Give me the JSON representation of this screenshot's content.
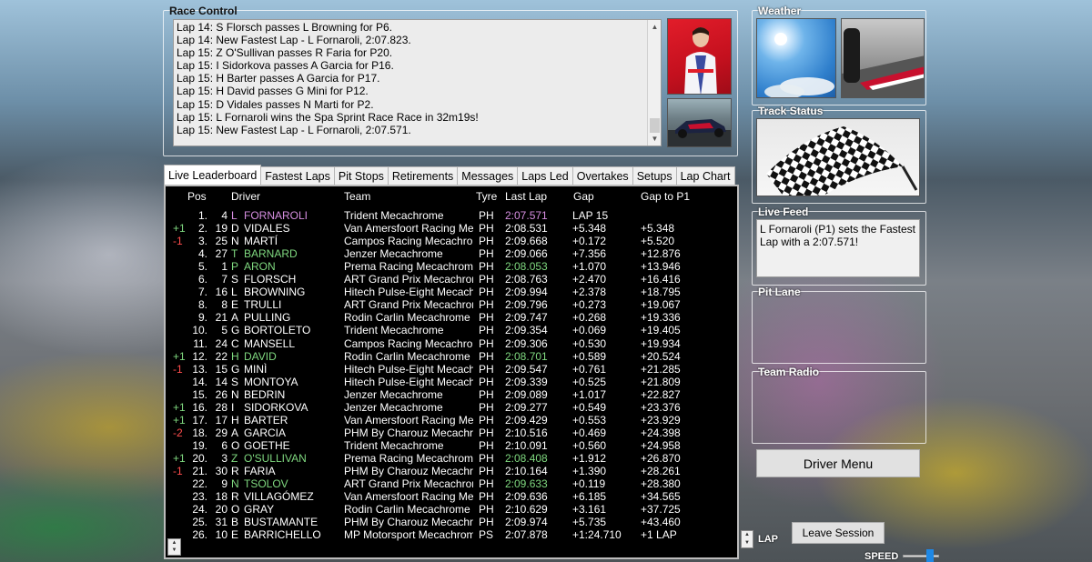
{
  "race_control": {
    "title": "Race Control",
    "messages": [
      "Lap 14: S Florsch passes L Browning for P6.",
      "Lap 14: New Fastest Lap - L Fornaroli, 2:07.823.",
      "Lap 15: Z O'Sullivan passes R Faria for P20.",
      "Lap 15: I Sidorkova passes A Garcia for P16.",
      "Lap 15: H Barter passes A Garcia for P17.",
      "Lap 15: H David passes G Mini for P12.",
      "Lap 15: D Vidales passes N Marti for P2.",
      "Lap 15: L Fornaroli wins the Spa Sprint Race Race in 32m19s!",
      "Lap 15: New Fastest Lap - L Fornaroli, 2:07.571."
    ]
  },
  "tabs": [
    "Live Leaderboard",
    "Fastest Laps",
    "Pit Stops",
    "Retirements",
    "Messages",
    "Laps Led",
    "Overtakes",
    "Setups",
    "Lap Chart"
  ],
  "leaderboard": {
    "headers": {
      "pos": "Pos",
      "driver": "Driver",
      "team": "Team",
      "tyre": "Tyre",
      "last_lap": "Last Lap",
      "gap": "Gap",
      "gap_p1": "Gap to P1"
    },
    "rows": [
      {
        "chg": "",
        "pos": "1.",
        "num": "4",
        "ini": "L",
        "sur": "FORNAROLI",
        "team": "Trident Mecachrome",
        "tyre": "PH",
        "last": "2:07.571",
        "gap": "LAP 15",
        "gp1": "",
        "name_color": "#d68ee0",
        "last_color": "#d68ee0"
      },
      {
        "chg": "+1",
        "pos": "2.",
        "num": "19",
        "ini": "D",
        "sur": "VIDALES",
        "team": "Van Amersfoort Racing Me",
        "tyre": "PH",
        "last": "2:08.531",
        "gap": "+5.348",
        "gp1": "+5.348",
        "name_color": "#ffffff",
        "last_color": "#ffffff"
      },
      {
        "chg": "-1",
        "pos": "3.",
        "num": "25",
        "ini": "N",
        "sur": "MARTÍ",
        "team": "Campos Racing Mecachro",
        "tyre": "PH",
        "last": "2:09.668",
        "gap": "+0.172",
        "gp1": "+5.520",
        "name_color": "#ffffff",
        "last_color": "#ffffff"
      },
      {
        "chg": "",
        "pos": "4.",
        "num": "27",
        "ini": "T",
        "sur": "BARNARD",
        "team": "Jenzer Mecachrome",
        "tyre": "PH",
        "last": "2:09.066",
        "gap": "+7.356",
        "gp1": "+12.876",
        "name_color": "#7fd87f",
        "last_color": "#ffffff"
      },
      {
        "chg": "",
        "pos": "5.",
        "num": "1",
        "ini": "P",
        "sur": "ARON",
        "team": "Prema Racing Mecachrom",
        "tyre": "PH",
        "last": "2:08.053",
        "gap": "+1.070",
        "gp1": "+13.946",
        "name_color": "#7fd87f",
        "last_color": "#7fd87f"
      },
      {
        "chg": "",
        "pos": "6.",
        "num": "7",
        "ini": "S",
        "sur": "FLORSCH",
        "team": "ART Grand Prix Mecachror",
        "tyre": "PH",
        "last": "2:08.763",
        "gap": "+2.470",
        "gp1": "+16.416",
        "name_color": "#ffffff",
        "last_color": "#ffffff"
      },
      {
        "chg": "",
        "pos": "7.",
        "num": "16",
        "ini": "L",
        "sur": "BROWNING",
        "team": "Hitech Pulse-Eight Mecach",
        "tyre": "PH",
        "last": "2:09.994",
        "gap": "+2.378",
        "gp1": "+18.795",
        "name_color": "#ffffff",
        "last_color": "#ffffff"
      },
      {
        "chg": "",
        "pos": "8.",
        "num": "8",
        "ini": "E",
        "sur": "TRULLI",
        "team": "ART Grand Prix Mecachror",
        "tyre": "PH",
        "last": "2:09.796",
        "gap": "+0.273",
        "gp1": "+19.067",
        "name_color": "#ffffff",
        "last_color": "#ffffff"
      },
      {
        "chg": "",
        "pos": "9.",
        "num": "21",
        "ini": "A",
        "sur": "PULLING",
        "team": "Rodin Carlin Mecachrome",
        "tyre": "PH",
        "last": "2:09.747",
        "gap": "+0.268",
        "gp1": "+19.336",
        "name_color": "#ffffff",
        "last_color": "#ffffff"
      },
      {
        "chg": "",
        "pos": "10.",
        "num": "5",
        "ini": "G",
        "sur": "BORTOLETO",
        "team": "Trident Mecachrome",
        "tyre": "PH",
        "last": "2:09.354",
        "gap": "+0.069",
        "gp1": "+19.405",
        "name_color": "#ffffff",
        "last_color": "#ffffff"
      },
      {
        "chg": "",
        "pos": "11.",
        "num": "24",
        "ini": "C",
        "sur": "MANSELL",
        "team": "Campos Racing Mecachro",
        "tyre": "PH",
        "last": "2:09.306",
        "gap": "+0.530",
        "gp1": "+19.934",
        "name_color": "#ffffff",
        "last_color": "#ffffff"
      },
      {
        "chg": "+1",
        "pos": "12.",
        "num": "22",
        "ini": "H",
        "sur": "DAVID",
        "team": "Rodin Carlin Mecachrome",
        "tyre": "PH",
        "last": "2:08.701",
        "gap": "+0.589",
        "gp1": "+20.524",
        "name_color": "#7fd87f",
        "last_color": "#7fd87f"
      },
      {
        "chg": "-1",
        "pos": "13.",
        "num": "15",
        "ini": "G",
        "sur": "MINÌ",
        "team": "Hitech Pulse-Eight Mecach",
        "tyre": "PH",
        "last": "2:09.547",
        "gap": "+0.761",
        "gp1": "+21.285",
        "name_color": "#ffffff",
        "last_color": "#ffffff"
      },
      {
        "chg": "",
        "pos": "14.",
        "num": "14",
        "ini": "S",
        "sur": "MONTOYA",
        "team": "Hitech Pulse-Eight Mecach",
        "tyre": "PH",
        "last": "2:09.339",
        "gap": "+0.525",
        "gp1": "+21.809",
        "name_color": "#ffffff",
        "last_color": "#ffffff"
      },
      {
        "chg": "",
        "pos": "15.",
        "num": "26",
        "ini": "N",
        "sur": "BEDRIN",
        "team": "Jenzer Mecachrome",
        "tyre": "PH",
        "last": "2:09.089",
        "gap": "+1.017",
        "gp1": "+22.827",
        "name_color": "#ffffff",
        "last_color": "#ffffff"
      },
      {
        "chg": "+1",
        "pos": "16.",
        "num": "28",
        "ini": "I",
        "sur": "SIDORKOVA",
        "team": "Jenzer Mecachrome",
        "tyre": "PH",
        "last": "2:09.277",
        "gap": "+0.549",
        "gp1": "+23.376",
        "name_color": "#ffffff",
        "last_color": "#ffffff"
      },
      {
        "chg": "+1",
        "pos": "17.",
        "num": "17",
        "ini": "H",
        "sur": "BARTER",
        "team": "Van Amersfoort Racing Me",
        "tyre": "PH",
        "last": "2:09.429",
        "gap": "+0.553",
        "gp1": "+23.929",
        "name_color": "#ffffff",
        "last_color": "#ffffff"
      },
      {
        "chg": "-2",
        "pos": "18.",
        "num": "29",
        "ini": "A",
        "sur": "GARCIA",
        "team": "PHM By Charouz Mecachrc",
        "tyre": "PH",
        "last": "2:10.516",
        "gap": "+0.469",
        "gp1": "+24.398",
        "name_color": "#ffffff",
        "last_color": "#ffffff"
      },
      {
        "chg": "",
        "pos": "19.",
        "num": "6",
        "ini": "O",
        "sur": "GOETHE",
        "team": "Trident Mecachrome",
        "tyre": "PH",
        "last": "2:10.091",
        "gap": "+0.560",
        "gp1": "+24.958",
        "name_color": "#ffffff",
        "last_color": "#ffffff"
      },
      {
        "chg": "+1",
        "pos": "20.",
        "num": "3",
        "ini": "Z",
        "sur": "O'SULLIVAN",
        "team": "Prema Racing Mecachrom",
        "tyre": "PH",
        "last": "2:08.408",
        "gap": "+1.912",
        "gp1": "+26.870",
        "name_color": "#7fd87f",
        "last_color": "#7fd87f"
      },
      {
        "chg": "-1",
        "pos": "21.",
        "num": "30",
        "ini": "R",
        "sur": "FARIA",
        "team": "PHM By Charouz Mecachrc",
        "tyre": "PH",
        "last": "2:10.164",
        "gap": "+1.390",
        "gp1": "+28.261",
        "name_color": "#ffffff",
        "last_color": "#ffffff"
      },
      {
        "chg": "",
        "pos": "22.",
        "num": "9",
        "ini": "N",
        "sur": "TSOLOV",
        "team": "ART Grand Prix Mecachror",
        "tyre": "PH",
        "last": "2:09.633",
        "gap": "+0.119",
        "gp1": "+28.380",
        "name_color": "#7fd87f",
        "last_color": "#7fd87f"
      },
      {
        "chg": "",
        "pos": "23.",
        "num": "18",
        "ini": "R",
        "sur": "VILLAGÓMEZ",
        "team": "Van Amersfoort Racing Me",
        "tyre": "PH",
        "last": "2:09.636",
        "gap": "+6.185",
        "gp1": "+34.565",
        "name_color": "#ffffff",
        "last_color": "#ffffff"
      },
      {
        "chg": "",
        "pos": "24.",
        "num": "20",
        "ini": "O",
        "sur": "GRAY",
        "team": "Rodin Carlin Mecachrome",
        "tyre": "PH",
        "last": "2:10.629",
        "gap": "+3.161",
        "gp1": "+37.725",
        "name_color": "#ffffff",
        "last_color": "#ffffff"
      },
      {
        "chg": "",
        "pos": "25.",
        "num": "31",
        "ini": "B",
        "sur": "BUSTAMANTE",
        "team": "PHM By Charouz Mecachrc",
        "tyre": "PH",
        "last": "2:09.974",
        "gap": "+5.735",
        "gp1": "+43.460",
        "name_color": "#ffffff",
        "last_color": "#ffffff"
      },
      {
        "chg": "",
        "pos": "26.",
        "num": "10",
        "ini": "E",
        "sur": "BARRICHELLO",
        "team": "MP Motorsport Mecachrom",
        "tyre": "PS",
        "last": "2:07.878",
        "gap": "+1:24.710",
        "gp1": "+1 LAP",
        "name_color": "#ffffff",
        "last_color": "#ffffff"
      }
    ]
  },
  "panels": {
    "weather": "Weather",
    "track_status": "Track Status",
    "live_feed": "Live Feed",
    "live_feed_text": "L Fornaroli (P1) sets the Fastest Lap with a 2:07.571!",
    "pit_lane": "Pit Lane",
    "team_radio": "Team Radio"
  },
  "buttons": {
    "driver_menu": "Driver Menu",
    "leave_session": "Leave Session"
  },
  "labels": {
    "lap": "LAP",
    "speed": "SPEED"
  },
  "colors": {
    "fastest": "#d68ee0",
    "improved": "#7fd87f",
    "gain": "#7fd87f",
    "loss": "#ff4d4d"
  }
}
